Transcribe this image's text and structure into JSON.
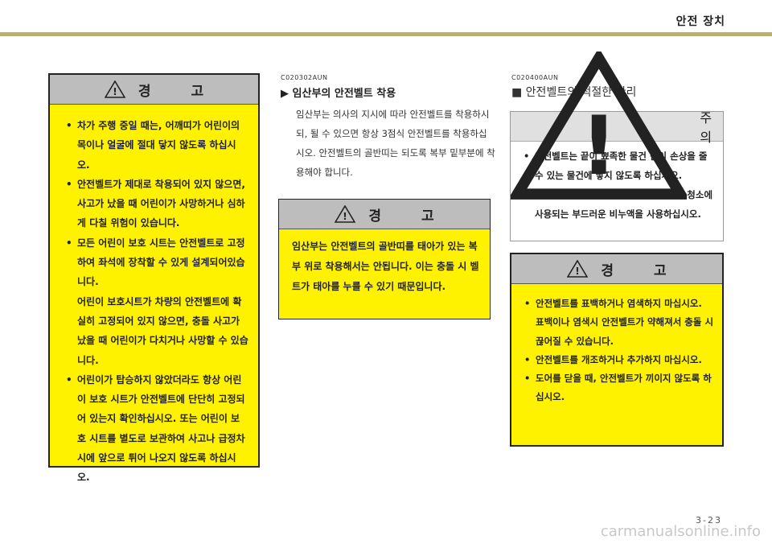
{
  "header": {
    "title": "안전 장치"
  },
  "left_warning": {
    "heading": "경 고",
    "items": [
      {
        "text": "차가 주행 중일 때는, 어깨띠가 어린이의 목이나 얼굴에 절대 닿지 않도록 하십시오."
      },
      {
        "text": "안전벨트가 제대로 착용되어 있지 않으면, 사고가 났을 때 어린이가 사망하거나 심하게 다칠 위험이 있습니다."
      },
      {
        "text": "모든 어린이 보호 시트는 안전벨트로 고정하여 좌석에 장착할 수 있게 설계되어있습니다.",
        "extra": "어린이 보호시트가 차량의 안전벨트에 확실히 고정되어 있지 않으면, 충돌 사고가 났을 때 어린이가 다치거나 사망할 수 있습니다."
      },
      {
        "text": "어린이가 탑승하지 않았더라도 항상 어린이 보호 시트가 안전벨트에 단단히 고정되어 있는지 확인하십시오. 또는 어린이 보호 시트를 별도로 보관하여 사고나 급정차 시에 앞으로 튀어 나오지 않도록 하십시오."
      }
    ]
  },
  "middle": {
    "code": "C020302AUN",
    "title": "▶ 임산부의 안전벨트 착용",
    "body": "임산부는 의사의 지시에 따라 안전벨트를 착용하시되, 될 수 있으면 항상 3점식 안전벨트를 착용하십시오. 안전벨트의 골반띠는 되도록 복부 밑부분에 착용해야 합니다.",
    "warning": {
      "heading": "경 고",
      "text": "임산부는 안전벨트의 골반띠를 태아가 있는 복부 위로 착용해서는 안됩니다. 이는 충돌 시 벨트가 태아를 누를 수 있기 때문입니다."
    }
  },
  "right": {
    "code": "C020400AUN",
    "title": "■ 안전벨트의 적절한 관리",
    "caution": {
      "heading": "주 의",
      "items": [
        {
          "text": "안전벨트는 끝이 뾰족한 물건 같이 손상을 줄 수 있는 물건에 닿지 않도록 하십시오."
        },
        {
          "text": "안전벨트를 청소할 때는 내장재나 카펫 청소에 사용되는 부드러운 비누액을 사용하십시오."
        }
      ]
    },
    "warning": {
      "heading": "경 고",
      "items": [
        {
          "text": "안전벨트를 표백하거나 염색하지 마십시오.",
          "extra": "표백이나 염색시 안전벨트가 약해져서 충돌 시 끊어질 수 있습니다."
        },
        {
          "text": "안전벨트를 개조하거나 추가하지 마십시오."
        },
        {
          "text": "도어를 닫을 때, 안전벨트가 끼이지 않도록 하십시오."
        }
      ]
    }
  },
  "footer": {
    "page_number": "3-23",
    "watermark": "carmanualsonline.info"
  },
  "icons": {
    "warning": "warning-triangle-icon"
  },
  "colors": {
    "warning_bg": "#fff200",
    "header_rule": "#b4b07a",
    "box_head": "#bdbdbd"
  }
}
